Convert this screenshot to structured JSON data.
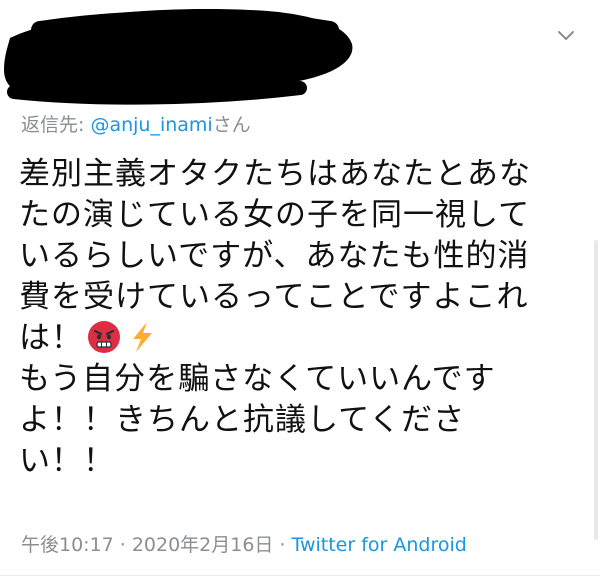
{
  "tweet": {
    "reply_prefix": "返信先: ",
    "reply_mention": "@anju_inami",
    "reply_suffix": "さん",
    "body_lines": [
      "差別主義オタクたちはあなたとあな",
      "たの演じている女の子を同一視して",
      "いるらしいですが、あなたも性的消",
      "費を受けているってことですよこれ",
      "は！",
      "もう自分を騙さなくていいんです",
      "よ！！きちんと抗議してくださ",
      "い！！"
    ],
    "emojis": [
      "angry-face-icon",
      "lightning-icon"
    ],
    "time": "午後10:17",
    "separator": "·",
    "date": "2020年2月16日",
    "source": "Twitter for Android"
  },
  "colors": {
    "link": "#1b95e0",
    "muted": "#8a8f94",
    "text": "#111111",
    "redaction": "#000000",
    "angry": "#dd2e44",
    "lightning": "#ffac33"
  }
}
